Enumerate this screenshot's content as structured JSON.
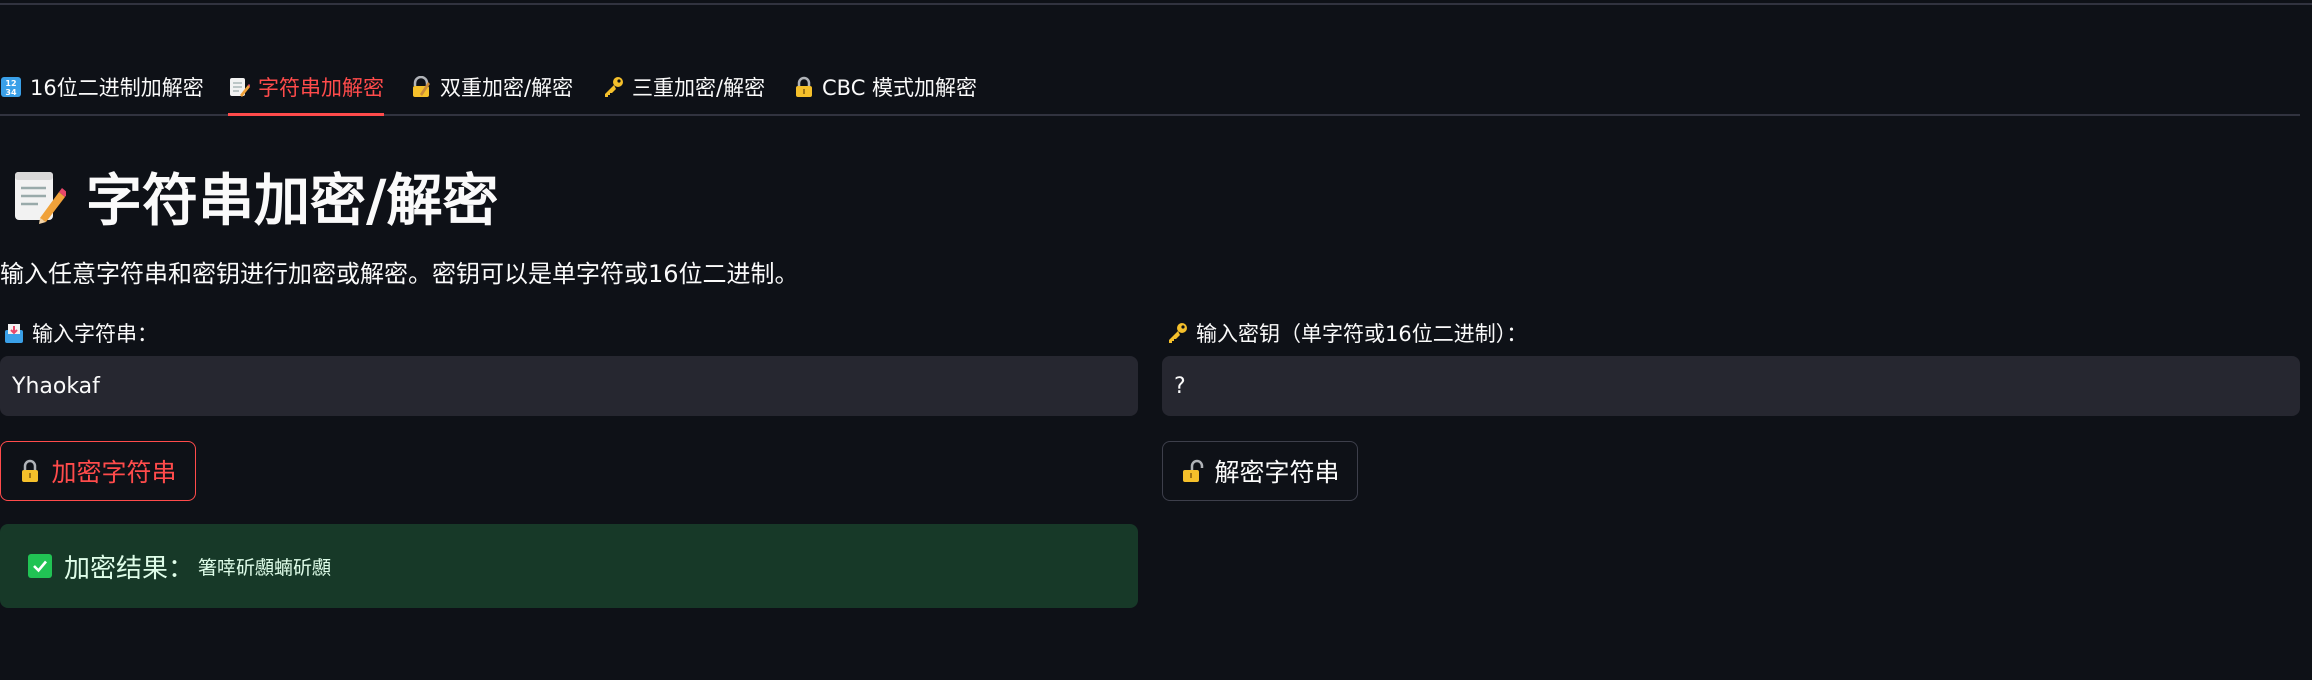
{
  "tabs": [
    {
      "label": "16位二进制加解密",
      "icon": "numbers-icon"
    },
    {
      "label": "字符串加解密",
      "icon": "memo-icon"
    },
    {
      "label": "双重加密/解密",
      "icon": "lock-with-pen-icon"
    },
    {
      "label": "三重加密/解密",
      "icon": "key-icon"
    },
    {
      "label": "CBC 模式加解密",
      "icon": "lock-icon"
    }
  ],
  "active_tab": 1,
  "page": {
    "title": "字符串加密/解密",
    "description": "输入任意字符串和密钥进行加密或解密。密钥可以是单字符或16位二进制。"
  },
  "inputs": {
    "string_label": "输入字符串：",
    "string_value": "Yhaokaf",
    "key_label": "输入密钥（单字符或16位二进制）：",
    "key_value": "?"
  },
  "buttons": {
    "encrypt_label": "加密字符串",
    "decrypt_label": "解密字符串"
  },
  "result": {
    "label": "加密结果：",
    "value": "箸啈斫䫲蝻斫䫲"
  },
  "colors": {
    "background": "#0e1117",
    "accent": "#ff4b4b",
    "input_bg": "#262730",
    "success_bg": "#173928",
    "success_icon": "#21c354"
  }
}
